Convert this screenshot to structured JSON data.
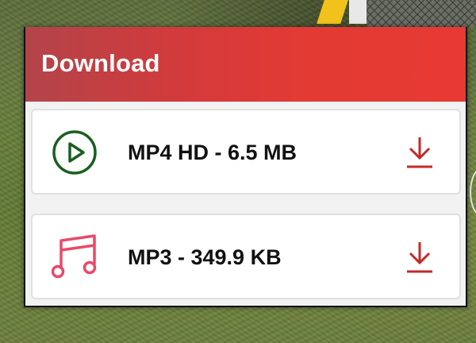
{
  "dialog": {
    "title": "Download",
    "colors": {
      "header_start": "#b3444a",
      "header_end": "#e63a33",
      "header_text": "#ffffff",
      "download_icon": "#c62828",
      "video_icon": "#1b5e20",
      "audio_icon": "#e84a6a"
    },
    "options": [
      {
        "label": "MP4 HD - 6.5 MB",
        "icon": "play-circle-icon",
        "action_icon": "download-icon"
      },
      {
        "label": "MP3 - 349.9 KB",
        "icon": "music-note-icon",
        "action_icon": "download-icon"
      }
    ]
  }
}
